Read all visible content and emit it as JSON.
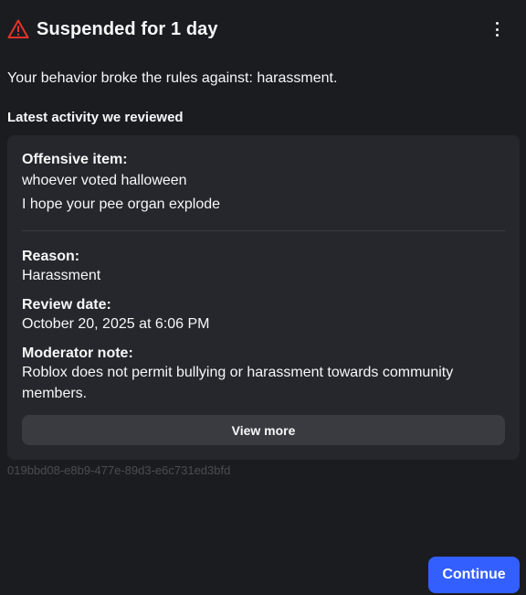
{
  "header": {
    "title": "Suspended for 1 day",
    "warning_icon": "warning-triangle-icon",
    "menu_icon": "more-vertical-icon",
    "warning_color": "#e5332a"
  },
  "message": "Your behavior broke the rules against: harassment.",
  "activity": {
    "heading": "Latest activity we reviewed",
    "offensive_item_label": "Offensive item:",
    "offensive_item_lines": [
      "whoever voted halloween",
      "I hope your pee organ explode"
    ],
    "reason_label": "Reason:",
    "reason_value": "Harassment",
    "review_date_label": "Review date:",
    "review_date_value": "October 20, 2025 at 6:06 PM",
    "moderator_note_label": "Moderator note:",
    "moderator_note_lines": [
      "Roblox does not permit bullying or harassment towards community",
      "members."
    ],
    "view_more_label": "View more"
  },
  "reference_id": "019bbd08-e8b9-477e-89d3-e6c731ed3bfd",
  "continue_label": "Continue",
  "colors": {
    "background": "#1b1c20",
    "card": "#25272c",
    "button_secondary": "#393b41",
    "accent": "#335fff"
  }
}
